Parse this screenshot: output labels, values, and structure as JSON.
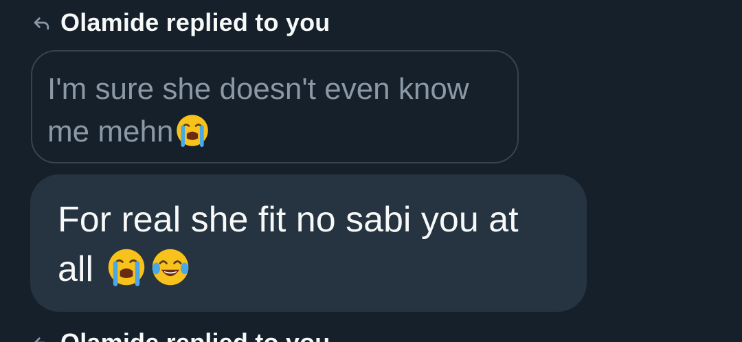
{
  "replies": [
    {
      "header": "Olamide replied to you",
      "quoted_text": "I'm sure she doesn't even know me mehn",
      "quoted_emoji": [
        "loudly-crying-face"
      ],
      "message_text": "For real she fit no sabi you at all",
      "message_emojis": [
        "loudly-crying-face",
        "face-with-tears-of-joy"
      ]
    },
    {
      "header": "Olamide replied to you"
    }
  ],
  "colors": {
    "background": "#15202b",
    "bubble": "#263340",
    "quoted_border": "#38444d",
    "primary_text": "#f7f9f9",
    "secondary_text": "#8b98a5"
  },
  "icons": {
    "reply": "reply-arrow-icon"
  }
}
